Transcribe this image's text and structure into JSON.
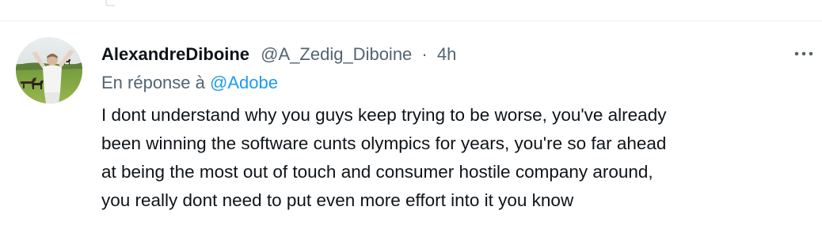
{
  "tweet": {
    "author": {
      "display_name": "AlexandreDiboine",
      "handle": "@A_Zedig_Diboine"
    },
    "separator": "·",
    "timestamp": "4h",
    "reply": {
      "prefix": "En réponse à",
      "mention": "@Adobe"
    },
    "text_lines": [
      "I dont understand why you guys keep trying to be worse, you've already",
      "been winning the software cunts olympics for years, you're so far ahead",
      "at being the most out of touch and consumer hostile company around,",
      "you really dont need to put even more effort into it you know"
    ],
    "more_icon": "more-horizontal-icon",
    "colors": {
      "text": "#0f1419",
      "secondary": "#536471",
      "link": "#1d9bf0",
      "divider": "#eff3f4"
    }
  }
}
